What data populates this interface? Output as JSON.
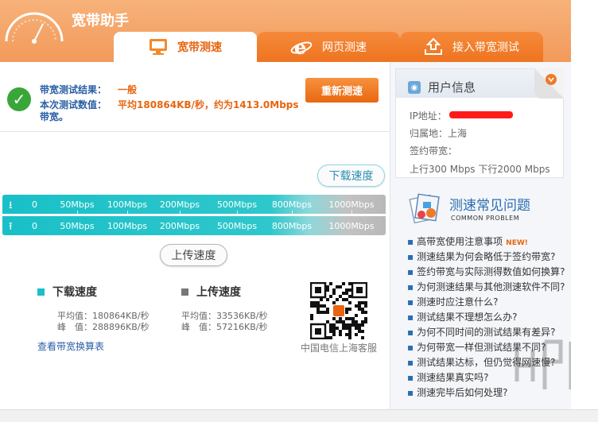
{
  "app": {
    "title": "宽带助手"
  },
  "tabs": [
    {
      "label": "宽带测速",
      "icon": "monitor-icon",
      "active": true
    },
    {
      "label": "网页测速",
      "icon": "ie-browser-icon",
      "active": false
    },
    {
      "label": "接入带宽测试",
      "icon": "upload-tray-icon",
      "active": false
    }
  ],
  "result": {
    "line1_label": "带宽测试结果：",
    "line1_value": "一般",
    "line2_label": "本次测试数值：",
    "line2_value": "平均180864KB/秒，约为1413.0Mbps",
    "line3": "带宽。",
    "retest_label": "重新测速"
  },
  "speed": {
    "download_bubble": "下载速度",
    "upload_bubble": "上传速度",
    "ticks": [
      "0",
      "50Mbps",
      "100Mbps",
      "200Mbps",
      "500Mbps",
      "800Mbps",
      "1000Mbps"
    ],
    "download_fill_fraction": 1.0,
    "upload_fill_fraction": 1.0,
    "colors": {
      "fill": "#19c0c8",
      "empty": "#bcbcbc"
    }
  },
  "stats": {
    "download": {
      "title": "下载速度",
      "avg": "平均值：180864KB/秒",
      "peak": "峰　值：288896KB/秒",
      "color": "#19c0c8"
    },
    "upload": {
      "title": "上传速度",
      "avg": "平均值：33536KB/秒",
      "peak": "峰　值：57216KB/秒",
      "color": "#777777"
    },
    "link": "查看带宽换算表",
    "qr_caption": "中国电信上海客服"
  },
  "user_info": {
    "title": "用户信息",
    "ip_label": "IP地址：",
    "location_label": "归属地：",
    "location_value": "上海",
    "bandwidth_label": "签约带宽：",
    "bandwidth_value": "上行300 Mbps 下行2000 Mbps"
  },
  "faq": {
    "title": "测速常见问题",
    "subtitle": "COMMON PROBLEM",
    "new_badge": "NEW!",
    "items": [
      "高带宽使用注意事项",
      "测速结果为何会略低于签约带宽?",
      "签约带宽与实际测得数值如何换算?",
      "为何测速结果与其他测速软件不同?",
      "测速时应注意什么?",
      "测试结果不理想怎么办?",
      "为何不同时间的测试结果有差异?",
      "为何带宽一样但测试结果不同?",
      "测试结果达标，但仍觉得网速慢?",
      "测速结果真实吗?",
      "测速完毕后如何处理?"
    ]
  }
}
